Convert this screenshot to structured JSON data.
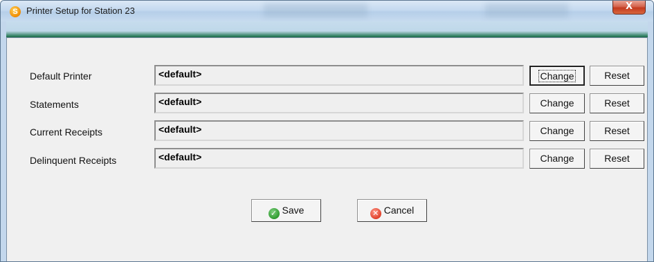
{
  "window": {
    "title": "Printer Setup for Station 23",
    "app_icon_glyph": "S",
    "close_glyph": "X"
  },
  "rows": [
    {
      "label": "Default Printer",
      "value": "<default>",
      "change_label": "Change",
      "reset_label": "Reset"
    },
    {
      "label": "Statements",
      "value": "<default>",
      "change_label": "Change",
      "reset_label": "Reset"
    },
    {
      "label": "Current Receipts",
      "value": "<default>",
      "change_label": "Change",
      "reset_label": "Reset"
    },
    {
      "label": "Delinquent Receipts",
      "value": "<default>",
      "change_label": "Change",
      "reset_label": "Reset"
    }
  ],
  "actions": {
    "save_label": "Save",
    "cancel_label": "Cancel",
    "save_icon": "check-circle-icon",
    "cancel_icon": "x-circle-icon"
  },
  "colors": {
    "client_bg": "#f0f0f0",
    "accent_green": "#2f7f5f",
    "close_red": "#c43a1e"
  }
}
